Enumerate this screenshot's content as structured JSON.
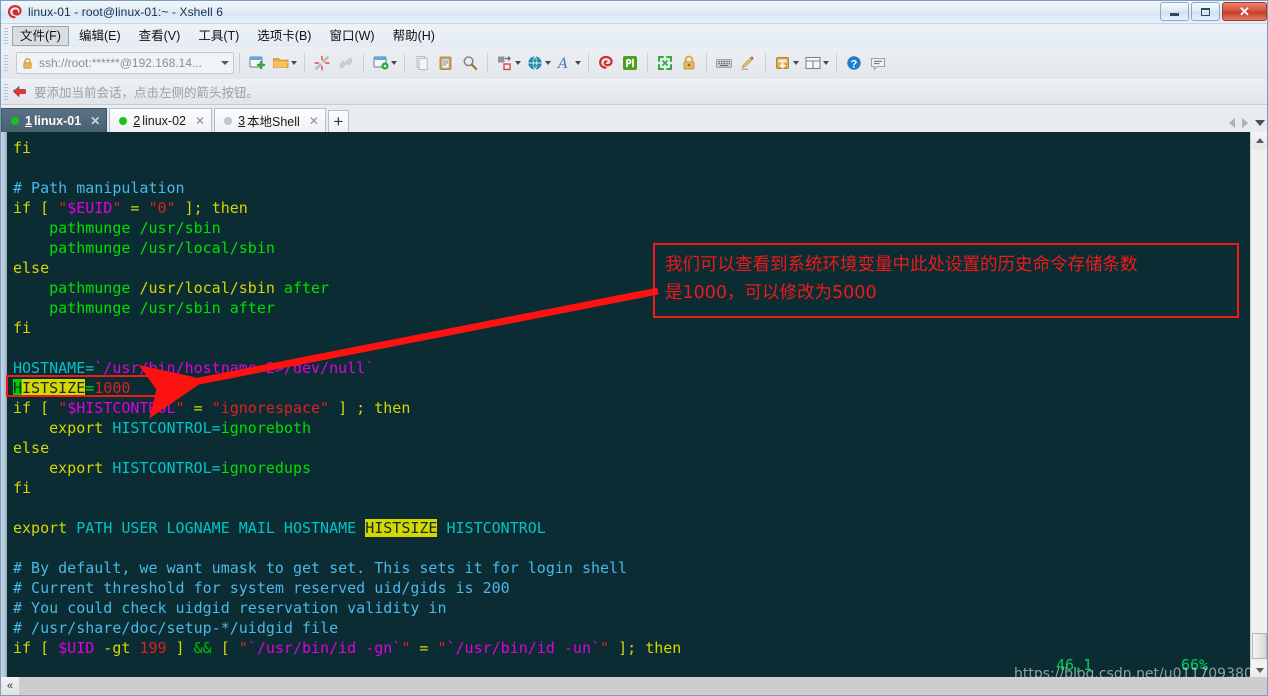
{
  "window": {
    "title": "linux-01 - root@linux-01:~ - Xshell 6",
    "logo_icon": "xshell-logo-icon",
    "controls": {
      "minimize": "minimize-button",
      "maximize": "maximize-button",
      "close": "close-button",
      "close_glyph": "✕"
    }
  },
  "menu": {
    "items": [
      {
        "label": "文件(F)",
        "active": true
      },
      {
        "label": "编辑(E)",
        "active": false
      },
      {
        "label": "查看(V)",
        "active": false
      },
      {
        "label": "工具(T)",
        "active": false
      },
      {
        "label": "选项卡(B)",
        "active": false
      },
      {
        "label": "窗口(W)",
        "active": false
      },
      {
        "label": "帮助(H)",
        "active": false
      }
    ]
  },
  "toolbar": {
    "address": {
      "value": "ssh://root:******@192.168.14...",
      "placeholder": "ssh://",
      "lock_icon": "lock-icon",
      "dropdown_icon": "chevron-down-icon"
    },
    "buttons": [
      "new-session-icon",
      "open-folder-icon",
      "disconnect-icon",
      "reconnect-icon",
      "session-properties-icon",
      "copy-icon",
      "paste-icon",
      "find-icon",
      "transfer-file-icon",
      "globe-icon",
      "font-icon",
      "xshell-icon",
      "xftp-icon",
      "fullscreen-icon",
      "lock-session-icon",
      "keyboard-icon",
      "compose-pane-icon",
      "add-pane-icon",
      "layout-icon",
      "help-icon",
      "feedback-icon"
    ]
  },
  "hintbar": {
    "arrow_icon": "red-arrow-icon",
    "text": "要添加当前会话，点击左侧的箭头按钮。"
  },
  "tabs": {
    "items": [
      {
        "num": "1",
        "label": "linux-01",
        "active": true,
        "connected": true,
        "close_icon": "close-icon"
      },
      {
        "num": "2",
        "label": "linux-02",
        "active": false,
        "connected": true,
        "close_icon": "close-icon"
      },
      {
        "num": "3",
        "label": "本地Shell",
        "active": false,
        "connected": false,
        "close_icon": "close-icon"
      }
    ],
    "add_label": "+",
    "nav": {
      "prev_icon": "chevron-left-icon",
      "next_icon": "chevron-right-icon",
      "list_icon": "chevron-down-icon"
    }
  },
  "terminal": {
    "background": "#0a2c32",
    "lines": [
      {
        "y": 0,
        "segs": [
          {
            "t": "fi",
            "c": "c-yel"
          }
        ]
      },
      {
        "y": 1,
        "segs": []
      },
      {
        "y": 2,
        "segs": [
          {
            "t": "# Path manipulation",
            "c": "c-blu"
          }
        ]
      },
      {
        "y": 3,
        "segs": [
          {
            "t": "if",
            "c": "c-yel"
          },
          {
            "t": " [ ",
            "c": "c-yel"
          },
          {
            "t": "\"",
            "c": "c-red"
          },
          {
            "t": "$EUID",
            "c": "c-mag"
          },
          {
            "t": "\"",
            "c": "c-red"
          },
          {
            "t": " = ",
            "c": "c-yel"
          },
          {
            "t": "\"0\"",
            "c": "c-red"
          },
          {
            "t": " ]; ",
            "c": "c-yel"
          },
          {
            "t": "then",
            "c": "c-yel"
          }
        ]
      },
      {
        "y": 4,
        "segs": [
          {
            "t": "    ",
            "c": "c-grn"
          },
          {
            "t": "pathmunge ",
            "c": "c-grn"
          },
          {
            "t": "/usr/sbin",
            "c": "c-grn"
          }
        ]
      },
      {
        "y": 5,
        "segs": [
          {
            "t": "    ",
            "c": "c-grn"
          },
          {
            "t": "pathmunge ",
            "c": "c-grn"
          },
          {
            "t": "/usr/local/sbin",
            "c": "c-grn"
          }
        ]
      },
      {
        "y": 6,
        "segs": [
          {
            "t": "else",
            "c": "c-yel"
          }
        ]
      },
      {
        "y": 7,
        "segs": [
          {
            "t": "    ",
            "c": "c-grn"
          },
          {
            "t": "pathmunge ",
            "c": "c-grn"
          },
          {
            "t": "/usr/local/sbin",
            "c": "c-yel"
          },
          {
            "t": " after",
            "c": "c-grn"
          }
        ]
      },
      {
        "y": 8,
        "segs": [
          {
            "t": "    ",
            "c": "c-grn"
          },
          {
            "t": "pathmunge ",
            "c": "c-grn"
          },
          {
            "t": "/usr/sbin",
            "c": "c-grn"
          },
          {
            "t": " after",
            "c": "c-grn"
          }
        ]
      },
      {
        "y": 9,
        "segs": [
          {
            "t": "fi",
            "c": "c-yel"
          }
        ]
      },
      {
        "y": 10,
        "segs": []
      },
      {
        "y": 11,
        "segs": [
          {
            "t": "HOSTNAME=",
            "c": "c-cyn"
          },
          {
            "t": "`/usr/bin/hostname 2>/dev/null`",
            "c": "c-mag"
          }
        ]
      },
      {
        "y": 12,
        "segs": [
          {
            "t": "H",
            "c": "cursor-cell"
          },
          {
            "t": "ISTSIZE",
            "c": "hl-yellow"
          },
          {
            "t": "=",
            "c": "c-grn"
          },
          {
            "t": "1000",
            "c": "c-red"
          }
        ]
      },
      {
        "y": 13,
        "segs": [
          {
            "t": "if",
            "c": "c-yel"
          },
          {
            "t": " [ ",
            "c": "c-yel"
          },
          {
            "t": "\"",
            "c": "c-red"
          },
          {
            "t": "$HISTCONTROL",
            "c": "c-mag"
          },
          {
            "t": "\"",
            "c": "c-red"
          },
          {
            "t": " = ",
            "c": "c-yel"
          },
          {
            "t": "\"ignorespace\"",
            "c": "c-red"
          },
          {
            "t": " ] ; ",
            "c": "c-yel"
          },
          {
            "t": "then",
            "c": "c-yel"
          }
        ]
      },
      {
        "y": 14,
        "segs": [
          {
            "t": "    ",
            "c": "c-yel"
          },
          {
            "t": "export",
            "c": "c-yel"
          },
          {
            "t": " HISTCONTROL=",
            "c": "c-cyn"
          },
          {
            "t": "ignoreboth",
            "c": "c-grn"
          }
        ]
      },
      {
        "y": 15,
        "segs": [
          {
            "t": "else",
            "c": "c-yel"
          }
        ]
      },
      {
        "y": 16,
        "segs": [
          {
            "t": "    ",
            "c": "c-yel"
          },
          {
            "t": "export",
            "c": "c-yel"
          },
          {
            "t": " HISTCONTROL=",
            "c": "c-cyn"
          },
          {
            "t": "ignoredups",
            "c": "c-grn"
          }
        ]
      },
      {
        "y": 17,
        "segs": [
          {
            "t": "fi",
            "c": "c-yel"
          }
        ]
      },
      {
        "y": 18,
        "segs": []
      },
      {
        "y": 19,
        "segs": [
          {
            "t": "export",
            "c": "c-yel"
          },
          {
            "t": " PATH USER LOGNAME MAIL HOSTNAME ",
            "c": "c-cyn"
          },
          {
            "t": "HISTSIZE",
            "c": "hl-yellow"
          },
          {
            "t": " HISTCONTROL",
            "c": "c-cyn"
          }
        ]
      },
      {
        "y": 20,
        "segs": []
      },
      {
        "y": 21,
        "segs": [
          {
            "t": "# By default, we want umask to get set. This sets it for login shell",
            "c": "c-blu"
          }
        ]
      },
      {
        "y": 22,
        "segs": [
          {
            "t": "# Current threshold for system reserved uid/gids is 200",
            "c": "c-blu"
          }
        ]
      },
      {
        "y": 23,
        "segs": [
          {
            "t": "# You could check uidgid reservation validity in",
            "c": "c-blu"
          }
        ]
      },
      {
        "y": 24,
        "segs": [
          {
            "t": "# /usr/share/doc/setup-*/uidgid file",
            "c": "c-blu"
          }
        ]
      },
      {
        "y": 25,
        "segs": [
          {
            "t": "if",
            "c": "c-yel"
          },
          {
            "t": " [ ",
            "c": "c-yel"
          },
          {
            "t": "$UID",
            "c": "c-mag"
          },
          {
            "t": " -gt ",
            "c": "c-yel"
          },
          {
            "t": "199",
            "c": "c-red"
          },
          {
            "t": " ] ",
            "c": "c-yel"
          },
          {
            "t": "&&",
            "c": "c-dgrn"
          },
          {
            "t": " [ ",
            "c": "c-yel"
          },
          {
            "t": "\"",
            "c": "c-red"
          },
          {
            "t": "`/usr/bin/id -gn`",
            "c": "c-mag"
          },
          {
            "t": "\"",
            "c": "c-red"
          },
          {
            "t": " = ",
            "c": "c-yel"
          },
          {
            "t": "\"",
            "c": "c-red"
          },
          {
            "t": "`/usr/bin/id -un`",
            "c": "c-mag"
          },
          {
            "t": "\"",
            "c": "c-red"
          },
          {
            "t": " ]; ",
            "c": "c-yel"
          },
          {
            "t": "then",
            "c": "c-yel"
          }
        ]
      }
    ]
  },
  "annotation": {
    "line1": "我们可以查看到系统环境变量中此处设置的历史命令存储条数",
    "line2": "是1000，可以修改为5000",
    "color": "#ef1a1a",
    "arrow": "red-arrow-pointing-to-histsize"
  },
  "status": {
    "position": "46,1",
    "percent": "66%",
    "watermark": "https://blog.csdn.net/u011709380"
  },
  "scrollbars": {
    "vertical": {
      "up_icon": "scroll-up-icon",
      "down_icon": "scroll-down-icon",
      "thumb": "vertical-scroll-thumb"
    },
    "horizontal": {
      "left_icon": "scroll-left-icon",
      "left_glyph": "«",
      "right_glyph": "»"
    }
  }
}
